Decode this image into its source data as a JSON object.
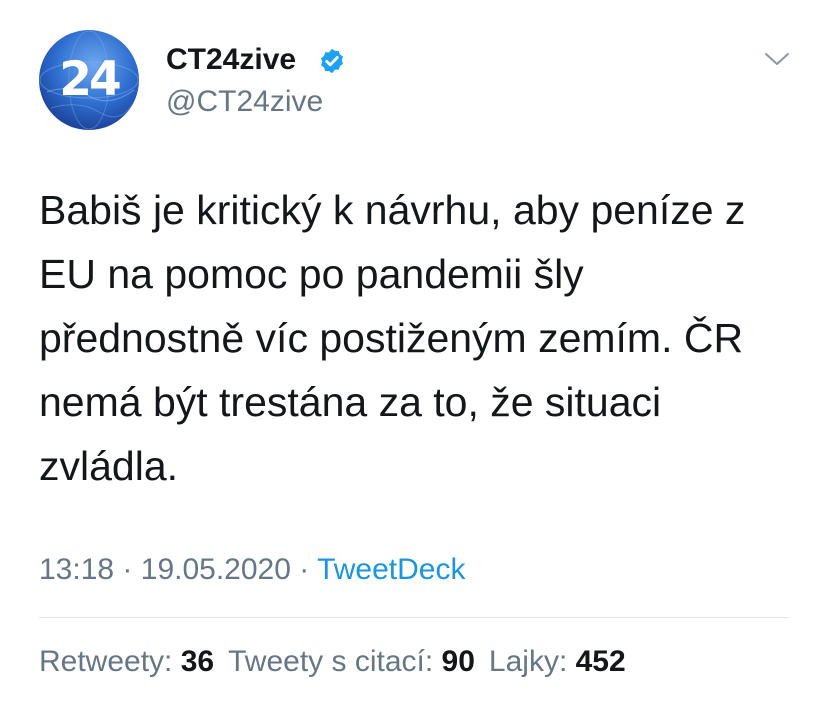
{
  "author": {
    "avatar_text": "24",
    "display_name": "CT24zive",
    "handle": "@CT24zive",
    "verified": true
  },
  "tweet": {
    "text": "Babiš je kritický k návrhu, aby peníze z\nEU na pomoc po pandemii šly\npřednostně víc postiženým zemím. ČR\nnemá být trestána za to, že situaci\nzvládla."
  },
  "meta": {
    "time": "13:18",
    "separator": "·",
    "date": "19.05.2020",
    "source": "TweetDeck"
  },
  "stats": {
    "retweets_label": "Retweety:",
    "retweets_count": "36",
    "quotes_label": "Tweety s citací:",
    "quotes_count": "90",
    "likes_label": "Lajky:",
    "likes_count": "452"
  },
  "colors": {
    "text": "#14171a",
    "secondary": "#657786",
    "link": "#1b95e0",
    "verified_badge": "#1da1f2",
    "divider": "#e1e8ed",
    "avatar_blue": "#2f6fd0"
  },
  "icons": {
    "verified": "verified-badge-icon",
    "more": "chevron-down-icon"
  }
}
